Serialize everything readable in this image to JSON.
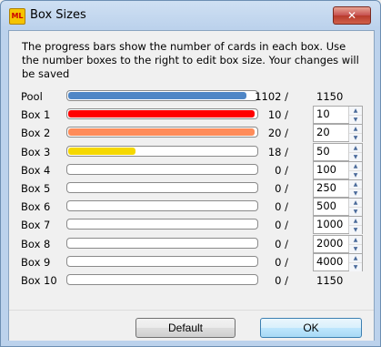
{
  "window": {
    "title": "Box Sizes",
    "icon_text": "ML",
    "close_glyph": "✕"
  },
  "description": "The progress bars show the number of cards in each box. Use the number boxes to the right to edit box size. Your changes will be saved",
  "colors": {
    "blue": "#4f86c6",
    "red": "#ff0000",
    "orange": "#ff8c5a",
    "yellow": "#f5d800"
  },
  "rows": [
    {
      "label": "Pool",
      "count": "1102 /",
      "size": "1150",
      "editable": false,
      "progress": 0.958,
      "color": "#4f86c6"
    },
    {
      "label": "Box 1",
      "count": "10 /",
      "size": "10",
      "editable": true,
      "progress": 1.0,
      "color": "#ff0000"
    },
    {
      "label": "Box 2",
      "count": "20 /",
      "size": "20",
      "editable": true,
      "progress": 1.0,
      "color": "#ff8c5a"
    },
    {
      "label": "Box 3",
      "count": "18 /",
      "size": "50",
      "editable": true,
      "progress": 0.36,
      "color": "#f5d800"
    },
    {
      "label": "Box 4",
      "count": "0 /",
      "size": "100",
      "editable": true,
      "progress": 0,
      "color": "#ffffff"
    },
    {
      "label": "Box 5",
      "count": "0 /",
      "size": "250",
      "editable": true,
      "progress": 0,
      "color": "#ffffff"
    },
    {
      "label": "Box 6",
      "count": "0 /",
      "size": "500",
      "editable": true,
      "progress": 0,
      "color": "#ffffff"
    },
    {
      "label": "Box 7",
      "count": "0 /",
      "size": "1000",
      "editable": true,
      "progress": 0,
      "color": "#ffffff"
    },
    {
      "label": "Box 8",
      "count": "0 /",
      "size": "2000",
      "editable": true,
      "progress": 0,
      "color": "#ffffff"
    },
    {
      "label": "Box 9",
      "count": "0 /",
      "size": "4000",
      "editable": true,
      "progress": 0,
      "color": "#ffffff"
    },
    {
      "label": "Box 10",
      "count": "0 /",
      "size": "1150",
      "editable": false,
      "progress": 0,
      "color": "#ffffff"
    }
  ],
  "buttons": {
    "default_label": "Default",
    "ok_label": "OK"
  }
}
